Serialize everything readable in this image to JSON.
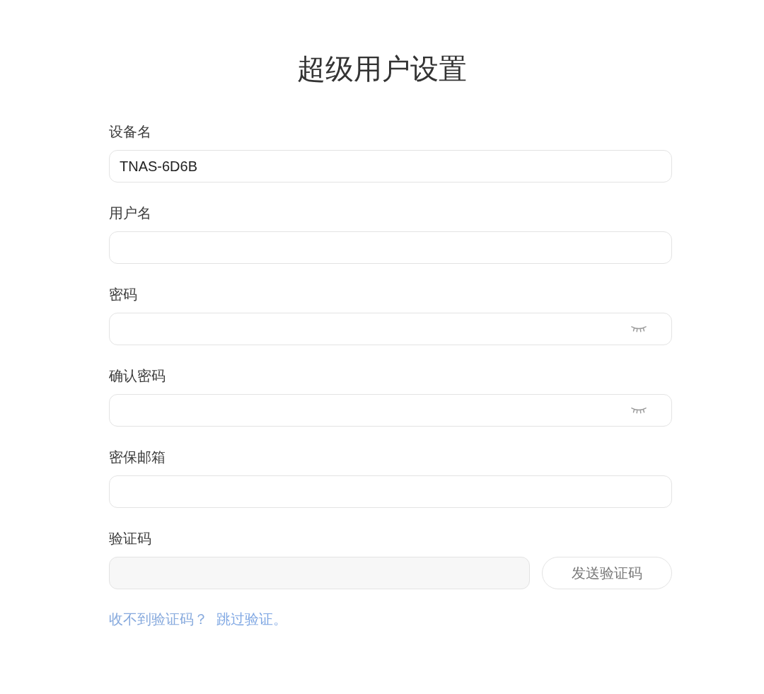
{
  "title": "超级用户设置",
  "fields": [
    {
      "kind": "text",
      "label": "设备名",
      "value": "TNAS-6D6B"
    },
    {
      "kind": "text",
      "label": "用户名"
    },
    {
      "kind": "password",
      "label": "密码"
    },
    {
      "kind": "password",
      "label": "确认密码"
    },
    {
      "kind": "text",
      "label": "密保邮箱"
    },
    {
      "kind": "code",
      "label": "验证码",
      "button": "发送验证码"
    }
  ],
  "help": {
    "text": "收不到验证码？",
    "link": "跳过验证。"
  }
}
